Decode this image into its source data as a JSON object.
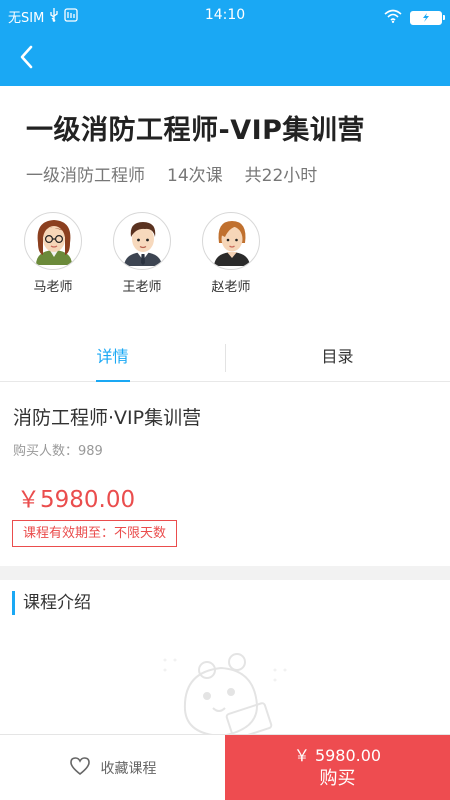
{
  "status_bar": {
    "carrier": "无SIM",
    "time": "14:10"
  },
  "course": {
    "title": "一级消防工程师-VIP集训营",
    "category": "一级消防工程师",
    "lessons": "14次课",
    "hours": "共22小时"
  },
  "teachers": [
    {
      "name": "马老师",
      "avatar": "female-teacher-glasses"
    },
    {
      "name": "王老师",
      "avatar": "male-teacher"
    },
    {
      "name": "赵老师",
      "avatar": "female-teacher"
    }
  ],
  "tabs": [
    {
      "label": "详情",
      "active": true
    },
    {
      "label": "目录",
      "active": false
    }
  ],
  "detail": {
    "name": "消防工程师·VIP集训营",
    "buyers": "购买人数：989",
    "price": "￥5980.00",
    "validity": "课程有效期至：不限天数"
  },
  "intro": {
    "heading": "课程介绍"
  },
  "bottom_bar": {
    "favorite_label": "收藏课程",
    "buy_price": "￥ 5980.00",
    "buy_label": "购买"
  },
  "colors": {
    "primary": "#1aa8f4",
    "accent_red": "#ea4d4d",
    "buy_button": "#ee4c50"
  }
}
